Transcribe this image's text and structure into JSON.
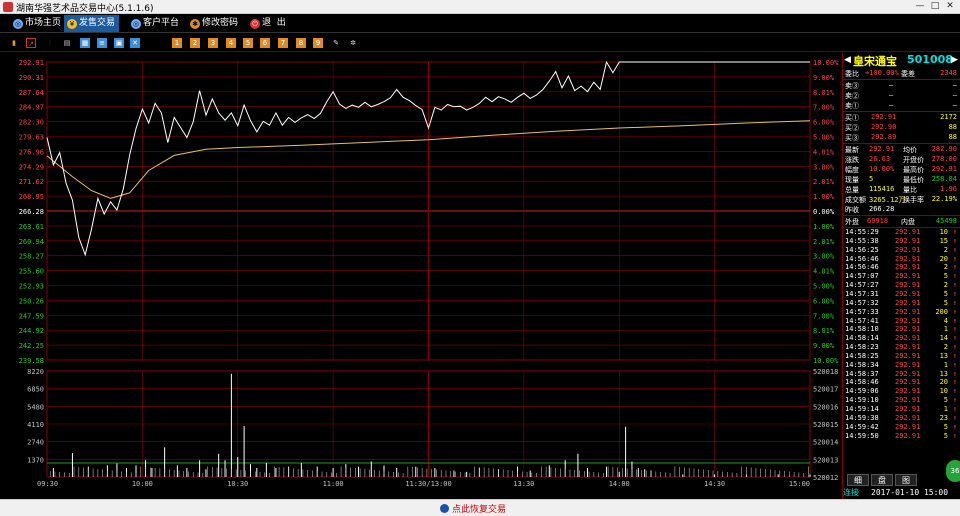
{
  "window": {
    "title": "湖南华强艺术品交易中心(5.1.1.6)",
    "min": "—",
    "max": "□",
    "close": "✕"
  },
  "menu": [
    {
      "label": "市场主页",
      "icon": "globe-icon"
    },
    {
      "label": "发售交易",
      "icon": "yen-icon",
      "active": true
    },
    {
      "label": "客户平台",
      "icon": "globe-icon"
    },
    {
      "label": "修改密码",
      "icon": "settings-icon"
    },
    {
      "label": "退  出",
      "icon": "power-icon"
    }
  ],
  "toolbar_icons": [
    "bar-chart-icon",
    "line-chart-icon",
    "candlestick-icon",
    "table-icon",
    "grid-icon",
    "list-icon",
    "window-icon",
    "close-box-icon",
    "f1-icon",
    "f2-icon",
    "f3-icon",
    "f4-icon",
    "f5-icon",
    "f6-icon",
    "f7-icon",
    "f8-icon",
    "f9-icon",
    "edit-icon",
    "gear-icon"
  ],
  "colors": {
    "up": "#ff4444",
    "down": "#22cc22",
    "flat": "#ffffff",
    "grid": "#8a0000",
    "price_line": "#ffffff",
    "avg_line": "#e8c060",
    "volume": "#ffffff",
    "yellow": "#ffff00",
    "cyan": "#00e0e0"
  },
  "chart_data": {
    "type": "line",
    "prev_close": 266.28,
    "price_ticks": [
      "292.91",
      "290.31",
      "287.64",
      "284.97",
      "282.30",
      "279.63",
      "276.96",
      "274.29",
      "271.62",
      "268.95",
      "266.28",
      "263.61",
      "260.94",
      "258.27",
      "255.60",
      "252.93",
      "250.26",
      "247.59",
      "244.92",
      "242.25",
      "239.58"
    ],
    "pct_ticks": [
      "10.00%",
      "9.00%",
      "8.01%",
      "7.00%",
      "6.00%",
      "5.00%",
      "4.01%",
      "3.00%",
      "2.01%",
      "1.00%",
      "0.00%",
      "1.00%",
      "2.01%",
      "3.00%",
      "4.01%",
      "5.00%",
      "6.00%",
      "7.00%",
      "8.01%",
      "9.00%",
      "10.00%"
    ],
    "ylim": [
      239.58,
      292.91
    ],
    "x_ticks": [
      "09:30",
      "10:00",
      "10:30",
      "11:00",
      "11:30/13:00",
      "13:30",
      "14:00",
      "14:30",
      "15:00"
    ],
    "price_series": [
      [
        0,
        279.4
      ],
      [
        2,
        274.5
      ],
      [
        4,
        276.7
      ],
      [
        6,
        271.2
      ],
      [
        8,
        268.2
      ],
      [
        10,
        261.5
      ],
      [
        12,
        258.4
      ],
      [
        14,
        263.0
      ],
      [
        16,
        268.5
      ],
      [
        18,
        265.7
      ],
      [
        20,
        267.9
      ],
      [
        22,
        266.4
      ],
      [
        24,
        270.2
      ],
      [
        26,
        276.3
      ],
      [
        28,
        281.0
      ],
      [
        30,
        284.5
      ],
      [
        32,
        282.0
      ],
      [
        34,
        285.5
      ],
      [
        36,
        283.8
      ],
      [
        38,
        278.5
      ],
      [
        40,
        283.0
      ],
      [
        42,
        281.2
      ],
      [
        44,
        279.4
      ],
      [
        46,
        282.2
      ],
      [
        48,
        287.8
      ],
      [
        50,
        283.4
      ],
      [
        52,
        286.3
      ],
      [
        54,
        283.8
      ],
      [
        56,
        282.5
      ],
      [
        58,
        283.8
      ],
      [
        60,
        281.5
      ],
      [
        62,
        285.2
      ],
      [
        64,
        282.4
      ],
      [
        66,
        280.4
      ],
      [
        68,
        282.3
      ],
      [
        70,
        281.6
      ],
      [
        72,
        283.8
      ],
      [
        74,
        281.6
      ],
      [
        76,
        283.0
      ],
      [
        78,
        282.1
      ],
      [
        80,
        282.9
      ],
      [
        82,
        283.5
      ],
      [
        84,
        282.8
      ],
      [
        86,
        283.7
      ],
      [
        88,
        285.8
      ],
      [
        90,
        287.6
      ],
      [
        92,
        285.4
      ],
      [
        94,
        284.6
      ],
      [
        96,
        285.2
      ],
      [
        98,
        284.8
      ],
      [
        100,
        285.7
      ],
      [
        102,
        284.9
      ],
      [
        104,
        285.3
      ],
      [
        106,
        285.8
      ],
      [
        108,
        286.5
      ],
      [
        110,
        288.0
      ],
      [
        112,
        286.6
      ],
      [
        114,
        286.0
      ],
      [
        116,
        285.1
      ],
      [
        118,
        284.4
      ],
      [
        120,
        281.1
      ],
      [
        122,
        284.8
      ],
      [
        124,
        284.3
      ],
      [
        126,
        285.3
      ],
      [
        128,
        284.9
      ],
      [
        130,
        285.0
      ],
      [
        132,
        284.3
      ],
      [
        134,
        284.8
      ],
      [
        136,
        285.5
      ],
      [
        138,
        286.6
      ],
      [
        140,
        285.8
      ],
      [
        142,
        286.7
      ],
      [
        144,
        286.3
      ],
      [
        146,
        285.7
      ],
      [
        148,
        286.6
      ],
      [
        150,
        287.3
      ],
      [
        152,
        286.4
      ],
      [
        154,
        287.0
      ],
      [
        156,
        288.0
      ],
      [
        158,
        289.5
      ],
      [
        160,
        291.2
      ],
      [
        162,
        288.3
      ],
      [
        164,
        290.4
      ],
      [
        166,
        287.8
      ],
      [
        168,
        288.6
      ],
      [
        170,
        287.6
      ],
      [
        172,
        289.3
      ],
      [
        174,
        288.0
      ],
      [
        176,
        292.9
      ],
      [
        178,
        291.0
      ],
      [
        180,
        292.91
      ],
      [
        186,
        292.91
      ],
      [
        190,
        292.91
      ],
      [
        200,
        292.91
      ],
      [
        210,
        292.91
      ],
      [
        220,
        292.91
      ],
      [
        230,
        292.91
      ],
      [
        240,
        292.91
      ]
    ],
    "avg_series": [
      [
        0,
        276.1
      ],
      [
        8,
        272.4
      ],
      [
        14,
        269.9
      ],
      [
        20,
        268.5
      ],
      [
        26,
        269.5
      ],
      [
        32,
        273.5
      ],
      [
        40,
        276.2
      ],
      [
        50,
        277.3
      ],
      [
        60,
        277.6
      ],
      [
        80,
        278.0
      ],
      [
        100,
        278.5
      ],
      [
        120,
        279.0
      ],
      [
        140,
        279.8
      ],
      [
        160,
        280.5
      ],
      [
        180,
        281.1
      ],
      [
        200,
        281.5
      ],
      [
        220,
        282.0
      ],
      [
        240,
        282.4
      ]
    ],
    "vol_ticks": [
      "8220",
      "6850",
      "5480",
      "4110",
      "2740",
      "1370"
    ],
    "oi_ticks": [
      "520018",
      "520017",
      "520016",
      "520015",
      "520014",
      "520013",
      "520012"
    ],
    "volume_max": 8220,
    "volume_series": [
      [
        2,
        700
      ],
      [
        8,
        1850
      ],
      [
        13,
        800
      ],
      [
        19,
        900
      ],
      [
        22,
        1050
      ],
      [
        25,
        700
      ],
      [
        28,
        900
      ],
      [
        31,
        1300
      ],
      [
        33,
        700
      ],
      [
        37,
        2300
      ],
      [
        41,
        900
      ],
      [
        44,
        700
      ],
      [
        48,
        1300
      ],
      [
        50,
        600
      ],
      [
        54,
        1800
      ],
      [
        56,
        1300
      ],
      [
        58,
        8000
      ],
      [
        60,
        1550
      ],
      [
        62,
        3950
      ],
      [
        64,
        1000
      ],
      [
        66,
        700
      ],
      [
        69,
        1100
      ],
      [
        72,
        700
      ],
      [
        76,
        800
      ],
      [
        80,
        1100
      ],
      [
        85,
        800
      ],
      [
        90,
        700
      ],
      [
        94,
        1000
      ],
      [
        98,
        800
      ],
      [
        102,
        1200
      ],
      [
        106,
        900
      ],
      [
        110,
        700
      ],
      [
        116,
        800
      ],
      [
        122,
        700
      ],
      [
        128,
        500
      ],
      [
        132,
        400
      ],
      [
        136,
        700
      ],
      [
        142,
        600
      ],
      [
        148,
        800
      ],
      [
        152,
        500
      ],
      [
        158,
        900
      ],
      [
        163,
        1300
      ],
      [
        167,
        1800
      ],
      [
        170,
        700
      ],
      [
        176,
        800
      ],
      [
        180,
        400
      ],
      [
        182,
        3900
      ],
      [
        184,
        1200
      ],
      [
        186,
        700
      ],
      [
        188,
        600
      ],
      [
        190,
        500
      ],
      [
        200,
        200
      ],
      [
        210,
        200
      ],
      [
        220,
        200
      ],
      [
        230,
        200
      ],
      [
        240,
        200
      ]
    ]
  },
  "stock": {
    "name": "皇宋通宝",
    "code": "501008"
  },
  "order_book": {
    "weibi_label": "委比",
    "weibi_value": "+100.00%",
    "weicha_label": "委差",
    "weicha_value": "2348",
    "asks": [
      {
        "label": "卖③",
        "price": "—",
        "vol": "—"
      },
      {
        "label": "卖②",
        "price": "—",
        "vol": "—"
      },
      {
        "label": "卖①",
        "price": "—",
        "vol": "—"
      }
    ],
    "bids": [
      {
        "label": "买①",
        "price": "292.91",
        "vol": "2172"
      },
      {
        "label": "买②",
        "price": "292.90",
        "vol": "88"
      },
      {
        "label": "买③",
        "price": "292.89",
        "vol": "88"
      }
    ]
  },
  "quote": [
    {
      "l1": "最新",
      "v1": "292.91",
      "l2": "均价",
      "v2": "282.90"
    },
    {
      "l1": "涨跌",
      "v1": "26.63",
      "l2": "开盘价",
      "v2": "278.00"
    },
    {
      "l1": "幅度",
      "v1": "10.00%",
      "l2": "最高价",
      "v2": "292.91"
    },
    {
      "l1": "现量",
      "v1": "5",
      "l2": "最低价",
      "v2": "258.04"
    },
    {
      "l1": "总量",
      "v1": "115416",
      "l2": "量比",
      "v2": "1.96"
    },
    {
      "l1": "成交额",
      "v1": "3265.12万",
      "l2": "换手率",
      "v2": "22.19%"
    },
    {
      "l1": "昨收",
      "v1": "266.28",
      "l2": "",
      "v2": ""
    }
  ],
  "outer_inner": {
    "out_label": "外盘",
    "out_value": "69918",
    "in_label": "内盘",
    "in_value": "45498"
  },
  "ticks": [
    {
      "time": "14:55:29",
      "price": "292.91",
      "vol": "10",
      "arrow": "↑"
    },
    {
      "time": "14:55:38",
      "price": "292.91",
      "vol": "15",
      "arrow": "↑"
    },
    {
      "time": "14:56:25",
      "price": "292.91",
      "vol": "2",
      "arrow": "↑"
    },
    {
      "time": "14:56:46",
      "price": "292.91",
      "vol": "20",
      "arrow": "↑"
    },
    {
      "time": "14:56:46",
      "price": "292.91",
      "vol": "2",
      "arrow": "↑"
    },
    {
      "time": "14:57:07",
      "price": "292.91",
      "vol": "5",
      "arrow": "↑"
    },
    {
      "time": "14:57:27",
      "price": "292.91",
      "vol": "2",
      "arrow": "↑"
    },
    {
      "time": "14:57:31",
      "price": "292.91",
      "vol": "5",
      "arrow": "↑"
    },
    {
      "time": "14:57:32",
      "price": "292.91",
      "vol": "5",
      "arrow": "↑"
    },
    {
      "time": "14:57:33",
      "price": "292.91",
      "vol": "200",
      "arrow": "↑"
    },
    {
      "time": "14:57:41",
      "price": "292.91",
      "vol": "4",
      "arrow": "↑"
    },
    {
      "time": "14:58:10",
      "price": "292.91",
      "vol": "1",
      "arrow": "↑"
    },
    {
      "time": "14:58:14",
      "price": "292.91",
      "vol": "14",
      "arrow": "↑"
    },
    {
      "time": "14:58:23",
      "price": "292.91",
      "vol": "2",
      "arrow": "↑"
    },
    {
      "time": "14:58:25",
      "price": "292.91",
      "vol": "13",
      "arrow": "↑"
    },
    {
      "time": "14:58:34",
      "price": "292.91",
      "vol": "1",
      "arrow": "↑"
    },
    {
      "time": "14:58:37",
      "price": "292.91",
      "vol": "13",
      "arrow": "↑"
    },
    {
      "time": "14:58:46",
      "price": "292.91",
      "vol": "20",
      "arrow": "↑"
    },
    {
      "time": "14:59:06",
      "price": "292.91",
      "vol": "10",
      "arrow": "↑"
    },
    {
      "time": "14:59:10",
      "price": "292.91",
      "vol": "5",
      "arrow": "↑"
    },
    {
      "time": "14:59:14",
      "price": "292.91",
      "vol": "1",
      "arrow": "↑"
    },
    {
      "time": "14:59:38",
      "price": "292.91",
      "vol": "23",
      "arrow": "↑"
    },
    {
      "time": "14:59:42",
      "price": "292.91",
      "vol": "5",
      "arrow": "↑"
    },
    {
      "time": "14:59:50",
      "price": "292.91",
      "vol": "5",
      "arrow": "↑"
    }
  ],
  "panel_tabs": [
    "细",
    "盘",
    "图"
  ],
  "status": {
    "conn": "连接",
    "datetime": "2017-01-10 15:00"
  },
  "bottom": {
    "resume": "点此恢复交易"
  },
  "side_bubble": "36"
}
